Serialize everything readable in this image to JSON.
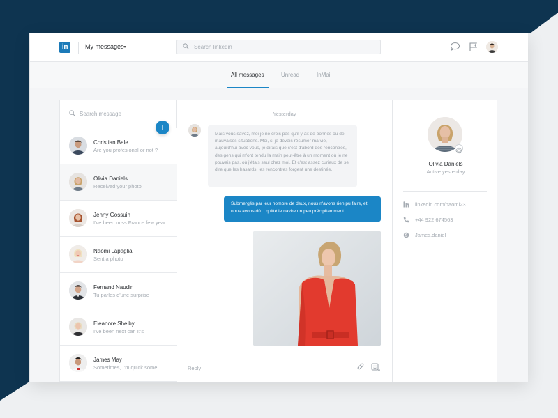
{
  "topbar": {
    "logo_text": "in",
    "title": "My messages",
    "search_placeholder": "Search linkedin"
  },
  "tabs": [
    {
      "label": "All messages",
      "active": true
    },
    {
      "label": "Unread",
      "active": false
    },
    {
      "label": "InMail",
      "active": false
    }
  ],
  "sidebar": {
    "search_placeholder": "Search message",
    "new_button": "+",
    "conversations": [
      {
        "name": "Christian Bale",
        "preview": "Are you profesional or not ?",
        "selected": false
      },
      {
        "name": "Olivia Daniels",
        "preview": "Received your photo",
        "selected": true
      },
      {
        "name": "Jenny Gossuin",
        "preview": "I've been miss France few year",
        "selected": false
      },
      {
        "name": "Naomi Lapaglia",
        "preview": "Sent a photo",
        "selected": false
      },
      {
        "name": "Fernand Naudin",
        "preview": "Tu parles d'une surprise",
        "selected": false
      },
      {
        "name": "Eleanore Shelby",
        "preview": "I've been next car. It's",
        "selected": false
      },
      {
        "name": "James May",
        "preview": "Sometimes, I'm quick some",
        "selected": false
      }
    ]
  },
  "chat": {
    "date_label": "Yesterday",
    "incoming_message": "Mais vous savez, moi je ne crois pas qu'il y ait de bonnes ou de mauvaises situations. Moi, si je devais résumer ma vie, aujourd'hui avec vous, je dirais que c'est d'abord des rencontres, des gens qui m'ont tendu la main peut-être à un moment où je ne pouvais pas, où j'étais seul chez moi. Et c'est assez curieux de se dire que les hasards, les rencontres forgent une destinée.",
    "outgoing_message": "Submergés par leur nombre de deux, nous n'avons rien pu faire, et nous avons dû... quitté le navire un peu précipitamment.",
    "reply_placeholder": "Reply"
  },
  "profile": {
    "name": "Olivia Daniels",
    "status": "Active yesterday",
    "linkedin": "linkedin.com/naomi23",
    "phone": "+44 922 674563",
    "skype": "James.daniel"
  },
  "colors": {
    "accent": "#1b86c6",
    "brand": "#1b7ab8",
    "navy_background": "#0e3450",
    "dress_red": "#e23a2e"
  }
}
